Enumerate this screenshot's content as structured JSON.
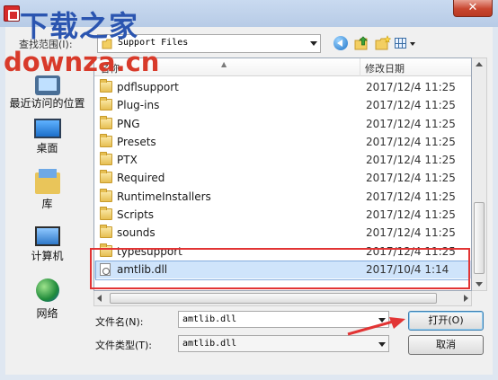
{
  "dialog": {
    "close_label": "✕"
  },
  "lookin": {
    "label": "查找范围(I):",
    "value": "Support Files"
  },
  "places": [
    {
      "label": "最近访问的位置"
    },
    {
      "label": "桌面"
    },
    {
      "label": "库"
    },
    {
      "label": "计算机"
    },
    {
      "label": "网络"
    }
  ],
  "columns": {
    "name": "名称",
    "date": "修改日期"
  },
  "files": [
    {
      "name": "pdflsupport",
      "date": "2017/12/4 11:25",
      "type": "folder"
    },
    {
      "name": "Plug-ins",
      "date": "2017/12/4 11:25",
      "type": "folder"
    },
    {
      "name": "PNG",
      "date": "2017/12/4 11:25",
      "type": "folder"
    },
    {
      "name": "Presets",
      "date": "2017/12/4 11:25",
      "type": "folder"
    },
    {
      "name": "PTX",
      "date": "2017/12/4 11:25",
      "type": "folder"
    },
    {
      "name": "Required",
      "date": "2017/12/4 11:25",
      "type": "folder"
    },
    {
      "name": "RuntimeInstallers",
      "date": "2017/12/4 11:25",
      "type": "folder"
    },
    {
      "name": "Scripts",
      "date": "2017/12/4 11:25",
      "type": "folder"
    },
    {
      "name": "sounds",
      "date": "2017/12/4 11:25",
      "type": "folder"
    },
    {
      "name": "typesupport",
      "date": "2017/12/4 11:25",
      "type": "folder"
    },
    {
      "name": "amtlib.dll",
      "date": "2017/10/4 1:14",
      "type": "file",
      "selected": true
    }
  ],
  "filename": {
    "label": "文件名(N):",
    "value": "amtlib.dll"
  },
  "filetype": {
    "label": "文件类型(T):",
    "value": "amtlib.dll"
  },
  "buttons": {
    "open": "打开(O)",
    "cancel": "取消"
  },
  "watermark": {
    "top": "下载之家",
    "bottom": "downza.cn"
  },
  "colors": {
    "highlight": "#e23434",
    "selection": "#cfe4fb",
    "watermark_blue": "#2b55b0",
    "watermark_red": "#d83a2a"
  }
}
